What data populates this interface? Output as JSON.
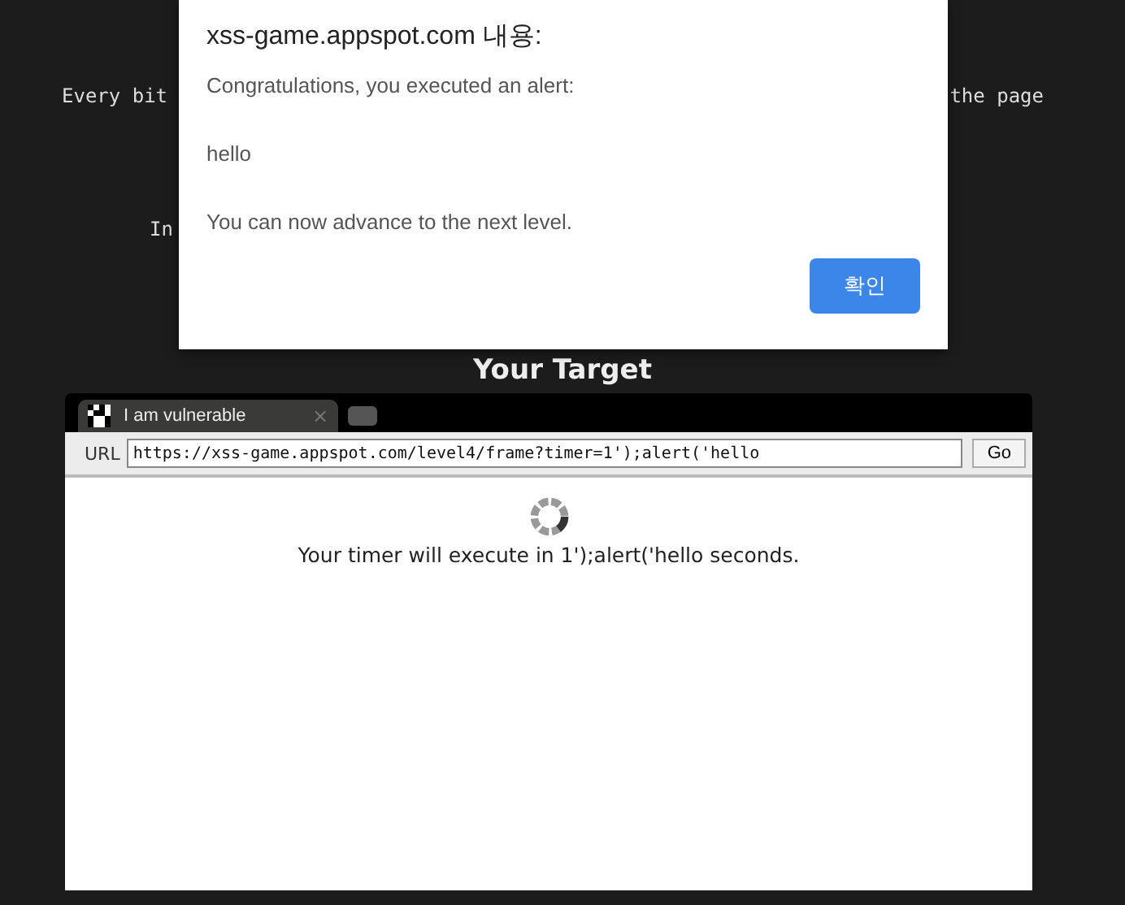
{
  "page": {
    "intro_left": "Every bit",
    "intro_right": "the page",
    "line_2": "In",
    "heading": "Your Target"
  },
  "browser": {
    "tab": {
      "title": "I am vulnerable",
      "close": "×"
    },
    "url_label": "URL",
    "url": "https://xss-game.appspot.com/level4/frame?timer=1');alert('hello",
    "go": "Go",
    "message": "Your timer will execute in 1');alert('hello seconds."
  },
  "dialog": {
    "title": "xss-game.appspot.com 내용:",
    "lines": [
      "Congratulations, you executed an alert:",
      "hello",
      "You can now advance to the next level."
    ],
    "button": "확인"
  }
}
